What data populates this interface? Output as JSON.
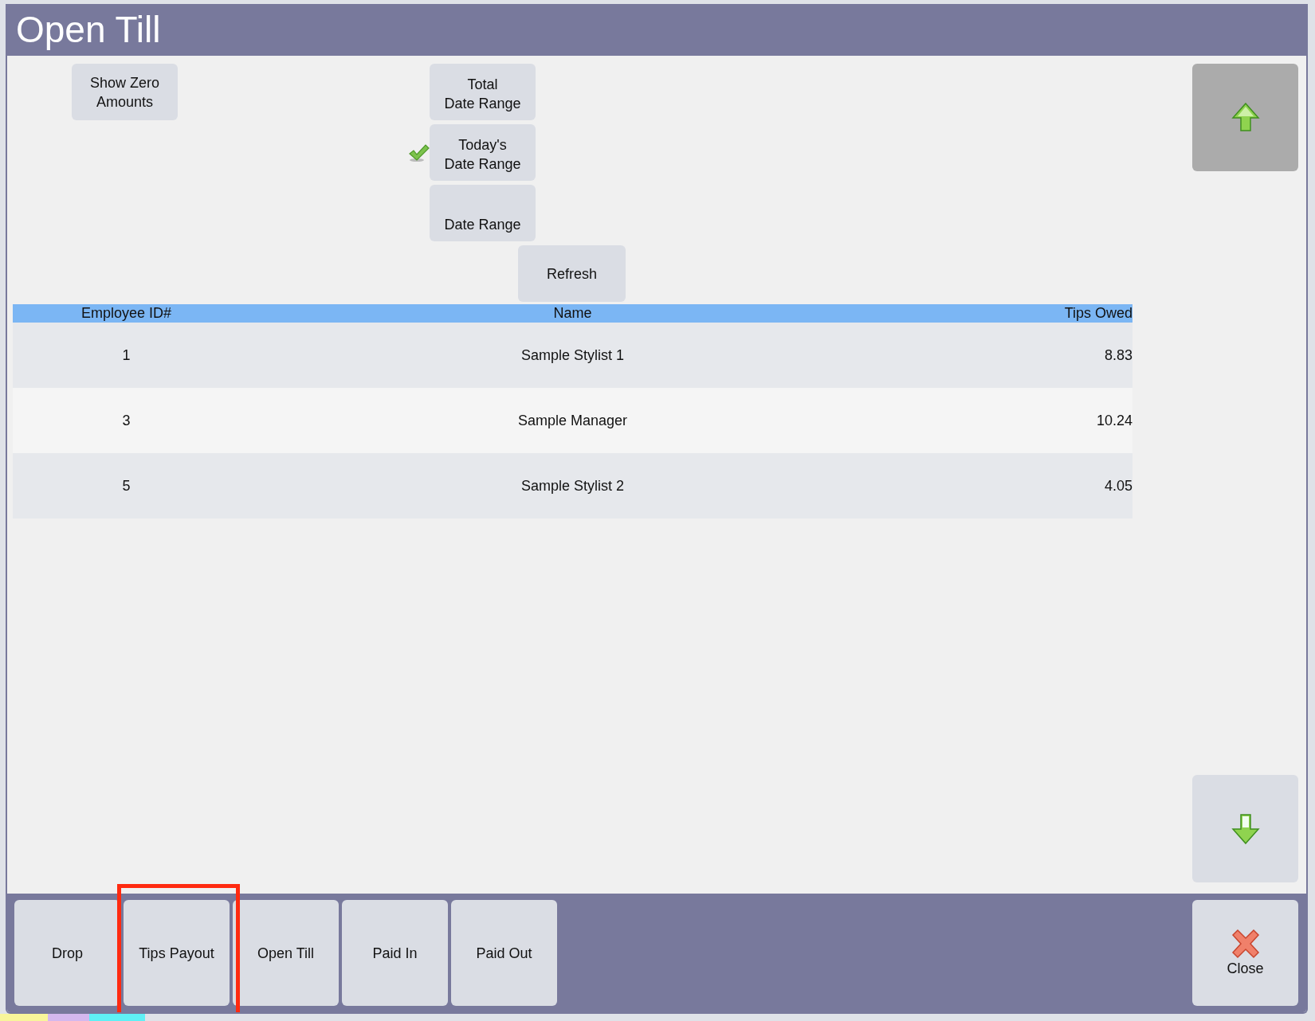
{
  "window": {
    "title": "Open Till"
  },
  "options": [
    {
      "lines": [
        "Show Zero",
        "Amounts"
      ]
    }
  ],
  "date_ranges": [
    {
      "lines": [
        "Total",
        "Date Range"
      ],
      "selected": false
    },
    {
      "lines": [
        "Today's",
        "Date Range"
      ],
      "selected": true
    },
    {
      "lines": [
        "Date Range"
      ],
      "selected": false
    }
  ],
  "refresh": {
    "label": "Refresh"
  },
  "table": {
    "columns": [
      {
        "label": "Employee ID#"
      },
      {
        "label": "Name"
      },
      {
        "label": "Tips Owed"
      }
    ],
    "rows": [
      [
        "1",
        "Sample Stylist 1",
        "8.83"
      ],
      [
        "3",
        "Sample Manager",
        "10.24"
      ],
      [
        "5",
        "Sample Stylist 2",
        "4.05"
      ]
    ]
  },
  "scroll_buttons": [
    {
      "kind": "up",
      "disabled": true
    },
    {
      "kind": "down",
      "disabled": false
    }
  ],
  "actions": [
    {
      "label": "Drop",
      "highlighted": false
    },
    {
      "label": "Tips Payout",
      "highlighted": true
    },
    {
      "label": "Open Till",
      "highlighted": false
    },
    {
      "label": "Paid In",
      "highlighted": false
    },
    {
      "label": "Paid Out",
      "highlighted": false
    }
  ],
  "close": {
    "label": "Close"
  }
}
